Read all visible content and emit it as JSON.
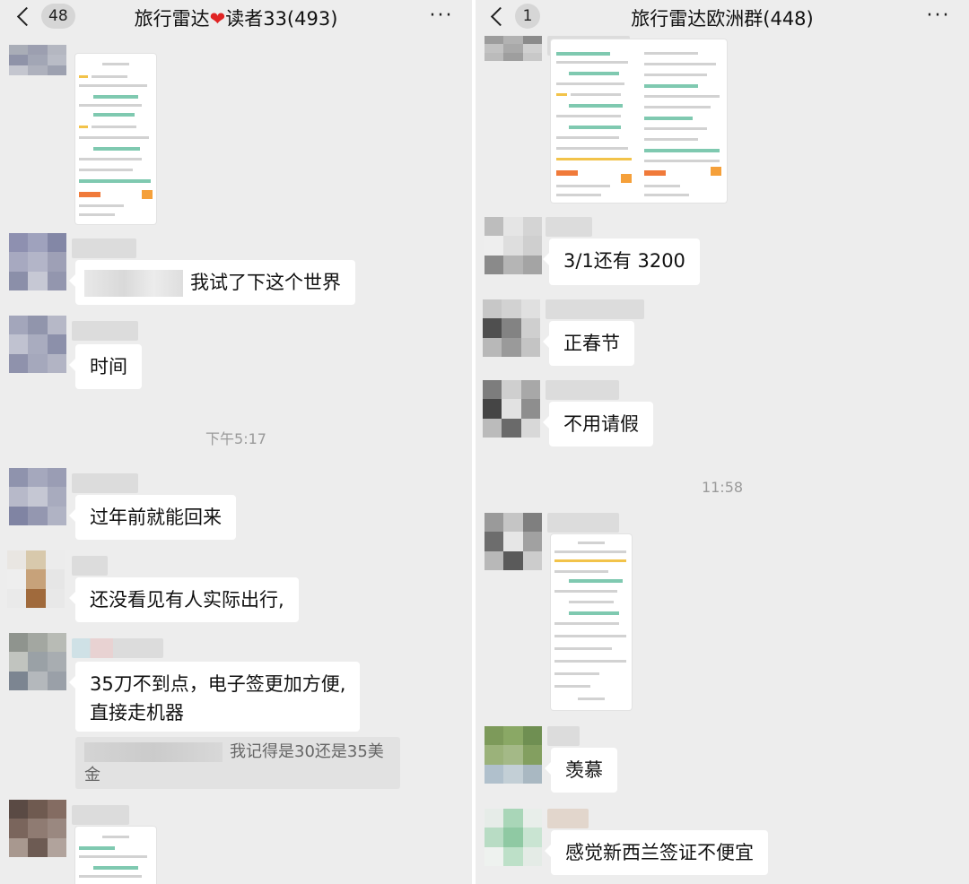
{
  "left": {
    "back_badge": "48",
    "title_a": "旅行雷达",
    "title_b": "读者33(493)",
    "more": "···",
    "messages": {
      "m1": "我试了下这个世界",
      "m2": "时间",
      "time1": "下午5:17",
      "m3": "过年前就能回来",
      "m4": "还没看见有人实际出行,",
      "m5_line1": "35刀不到点，电子签更加方便,",
      "m5_line2": "直接走机器",
      "quote_line1": "我记得是30还是35美",
      "quote_line2": "金"
    }
  },
  "right": {
    "back_badge": "1",
    "title": "旅行雷达欧洲群(448)",
    "more": "···",
    "messages": {
      "m1": "3/1还有 3200",
      "m2": "正春节",
      "m3": "不用请假",
      "time1": "11:58",
      "m4": "羡慕",
      "m5": "感觉新西兰签证不便宜"
    }
  },
  "colors": {
    "chat_background": "#ededed",
    "bubble": "#ffffff",
    "heart": "#e02424",
    "timestamp": "#9a9a9a"
  },
  "icons": {
    "back": "chevron-left-icon",
    "more": "more-dots-icon",
    "heart": "heart-icon"
  }
}
